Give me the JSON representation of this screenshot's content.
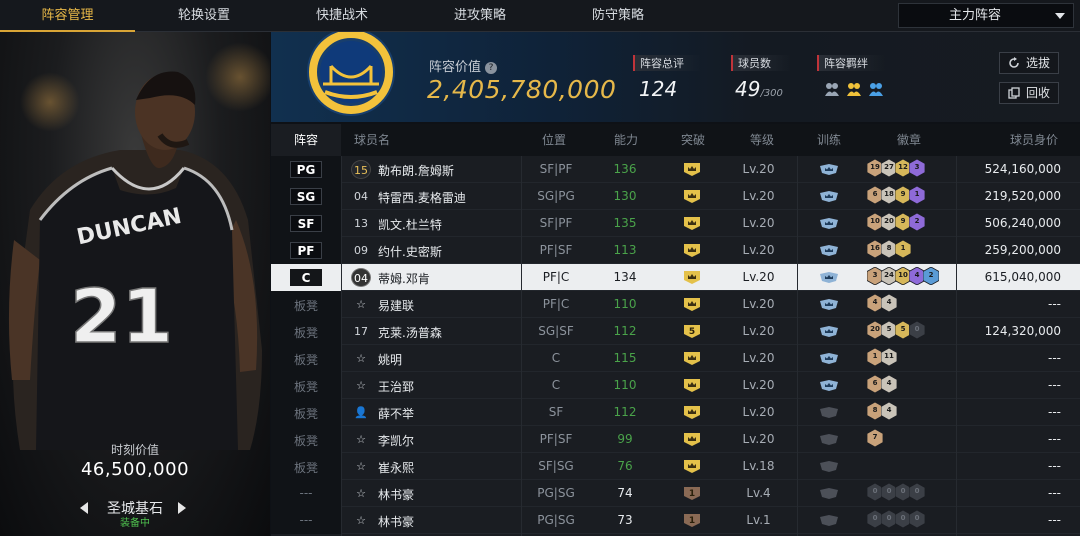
{
  "nav": {
    "tabs": [
      {
        "label": "阵容管理",
        "active": true
      },
      {
        "label": "轮换设置",
        "active": false
      },
      {
        "label": "快捷战术",
        "active": false
      },
      {
        "label": "进攻策略",
        "active": false
      },
      {
        "label": "防守策略",
        "active": false
      }
    ],
    "lineup_select": "主力阵容"
  },
  "player_card": {
    "jersey_name": "DUNCAN",
    "jersey_number": "21",
    "moment_label": "时刻价值",
    "moment_value": "46,500,000",
    "card_name": "圣城基石",
    "card_status": "装备中"
  },
  "summary": {
    "value_label": "阵容价值",
    "value": "2,405,780,000",
    "rating_label": "阵容总评",
    "rating": "124",
    "count_label": "球员数",
    "count": "49",
    "count_max": "/300",
    "bond_label": "阵容羁绊",
    "select_button": "选拔",
    "recycle_button": "回收"
  },
  "table": {
    "headers": {
      "slot": "阵容",
      "name": "球员名",
      "position": "位置",
      "ability": "能力",
      "breakthrough": "突破",
      "level": "等级",
      "training": "训练",
      "medals": "徽章",
      "worth": "球员身价"
    },
    "rows": [
      {
        "slot": "PG",
        "bench": false,
        "jersey": "15",
        "jersey_style": "badge",
        "name": "勒布朗.詹姆斯",
        "position": "SF|PF",
        "ability": "136",
        "ability_green": true,
        "breakthrough": "crown",
        "level": "Lv.20",
        "training": "blue",
        "medals": [
          "19",
          "27",
          "12",
          "3"
        ],
        "worth": "524,160,000"
      },
      {
        "slot": "SG",
        "bench": false,
        "jersey": "04",
        "jersey_style": "plain",
        "name": "特雷西.麦格雷迪",
        "position": "SG|PG",
        "ability": "130",
        "ability_green": true,
        "breakthrough": "crown",
        "level": "Lv.20",
        "training": "blue",
        "medals": [
          "6",
          "18",
          "9",
          "1"
        ],
        "worth": "219,520,000"
      },
      {
        "slot": "SF",
        "bench": false,
        "jersey": "13",
        "jersey_style": "plain",
        "name": "凯文.杜兰特",
        "position": "SF|PF",
        "ability": "135",
        "ability_green": true,
        "breakthrough": "crown",
        "level": "Lv.20",
        "training": "blue",
        "medals": [
          "10",
          "20",
          "9",
          "2"
        ],
        "worth": "506,240,000"
      },
      {
        "slot": "PF",
        "bench": false,
        "jersey": "09",
        "jersey_style": "plain",
        "name": "约什.史密斯",
        "position": "PF|SF",
        "ability": "113",
        "ability_green": true,
        "breakthrough": "crown",
        "level": "Lv.20",
        "training": "blue",
        "medals": [
          "16",
          "8",
          "1"
        ],
        "worth": "259,200,000"
      },
      {
        "slot": "C",
        "bench": false,
        "selected": true,
        "jersey": "04",
        "jersey_style": "dark",
        "name": "蒂姆.邓肯",
        "position": "PF|C",
        "ability": "134",
        "ability_green": false,
        "breakthrough": "crown",
        "level": "Lv.20",
        "training": "blue",
        "medals": [
          "3",
          "24",
          "10",
          "4",
          "2"
        ],
        "worth": "615,040,000"
      },
      {
        "slot": "板凳",
        "bench": true,
        "jersey": "☆",
        "jersey_style": "star",
        "name": "易建联",
        "position": "PF|C",
        "ability": "110",
        "ability_green": true,
        "breakthrough": "crown",
        "level": "Lv.20",
        "training": "blue",
        "medals": [
          "4",
          "4"
        ],
        "worth": "---"
      },
      {
        "slot": "板凳",
        "bench": true,
        "jersey": "17",
        "jersey_style": "plain",
        "name": "克莱.汤普森",
        "position": "SG|SF",
        "ability": "112",
        "ability_green": true,
        "breakthrough": "5",
        "level": "Lv.20",
        "training": "blue",
        "medals": [
          "20",
          "5",
          "5",
          "0"
        ],
        "worth": "124,320,000"
      },
      {
        "slot": "板凳",
        "bench": true,
        "jersey": "☆",
        "jersey_style": "star",
        "name": "姚明",
        "position": "C",
        "ability": "115",
        "ability_green": true,
        "breakthrough": "crown",
        "level": "Lv.20",
        "training": "blue",
        "medals": [
          "1",
          "11"
        ],
        "worth": "---"
      },
      {
        "slot": "板凳",
        "bench": true,
        "jersey": "☆",
        "jersey_style": "star",
        "name": "王治郅",
        "position": "C",
        "ability": "110",
        "ability_green": true,
        "breakthrough": "crown",
        "level": "Lv.20",
        "training": "blue",
        "medals": [
          "6",
          "4"
        ],
        "worth": "---"
      },
      {
        "slot": "板凳",
        "bench": true,
        "jersey": "👤",
        "jersey_style": "person",
        "name": "薛不举",
        "position": "SF",
        "ability": "112",
        "ability_green": true,
        "breakthrough": "crown",
        "level": "Lv.20",
        "training": "gray",
        "medals": [
          "8",
          "4"
        ],
        "worth": "---"
      },
      {
        "slot": "板凳",
        "bench": true,
        "jersey": "☆",
        "jersey_style": "star",
        "name": "李凯尔",
        "position": "PF|SF",
        "ability": "99",
        "ability_green": true,
        "breakthrough": "crown",
        "level": "Lv.20",
        "training": "gray",
        "medals": [
          "7"
        ],
        "worth": "---"
      },
      {
        "slot": "板凳",
        "bench": true,
        "jersey": "☆",
        "jersey_style": "star",
        "name": "崔永熙",
        "position": "SF|SG",
        "ability": "76",
        "ability_green": true,
        "breakthrough": "crown",
        "level": "Lv.18",
        "training": "gray",
        "medals": [],
        "worth": "---"
      },
      {
        "slot": "---",
        "bench": true,
        "jersey": "☆",
        "jersey_style": "star",
        "name": "林书豪",
        "position": "PG|SG",
        "ability": "74",
        "ability_green": false,
        "breakthrough": "1",
        "level": "Lv.4",
        "training": "gray",
        "medals": [
          "0",
          "0",
          "0",
          "0"
        ],
        "worth": "---"
      },
      {
        "slot": "---",
        "bench": true,
        "jersey": "☆",
        "jersey_style": "star",
        "name": "林书豪",
        "position": "PG|SG",
        "ability": "73",
        "ability_green": false,
        "breakthrough": "1",
        "level": "Lv.1",
        "training": "gray",
        "medals": [
          "0",
          "0",
          "0",
          "0"
        ],
        "worth": "---"
      }
    ]
  },
  "colors": {
    "accent": "#e6b84a",
    "ability_green": "#4aa34a",
    "status_red": "#c0343a",
    "selected_row": "#eceef0"
  }
}
